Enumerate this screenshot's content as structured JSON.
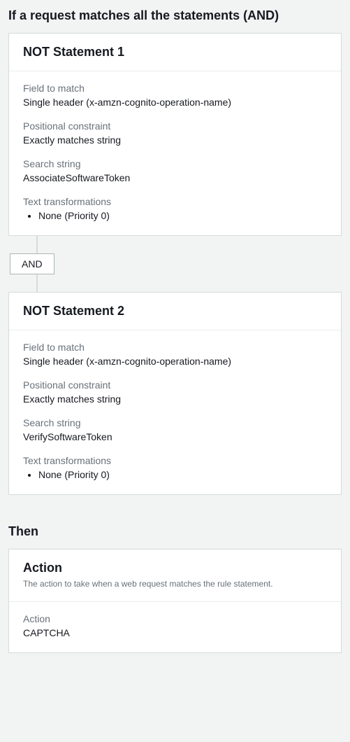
{
  "if_section": {
    "title": "If a request matches all the statements (AND)"
  },
  "statements": [
    {
      "title": "NOT Statement 1",
      "field_to_match_label": "Field to match",
      "field_to_match_value": "Single header (x-amzn-cognito-operation-name)",
      "positional_label": "Positional constraint",
      "positional_value": "Exactly matches string",
      "search_label": "Search string",
      "search_value": "AssociateSoftwareToken",
      "transforms_label": "Text transformations",
      "transforms_item": "None (Priority 0)"
    },
    {
      "title": "NOT Statement 2",
      "field_to_match_label": "Field to match",
      "field_to_match_value": "Single header (x-amzn-cognito-operation-name)",
      "positional_label": "Positional constraint",
      "positional_value": "Exactly matches string",
      "search_label": "Search string",
      "search_value": "VerifySoftwareToken",
      "transforms_label": "Text transformations",
      "transforms_item": "None (Priority 0)"
    }
  ],
  "connector": {
    "label": "AND"
  },
  "then_section": {
    "title": "Then",
    "action_header": "Action",
    "action_subtitle": "The action to take when a web request matches the rule statement.",
    "action_label": "Action",
    "action_value": "CAPTCHA"
  }
}
